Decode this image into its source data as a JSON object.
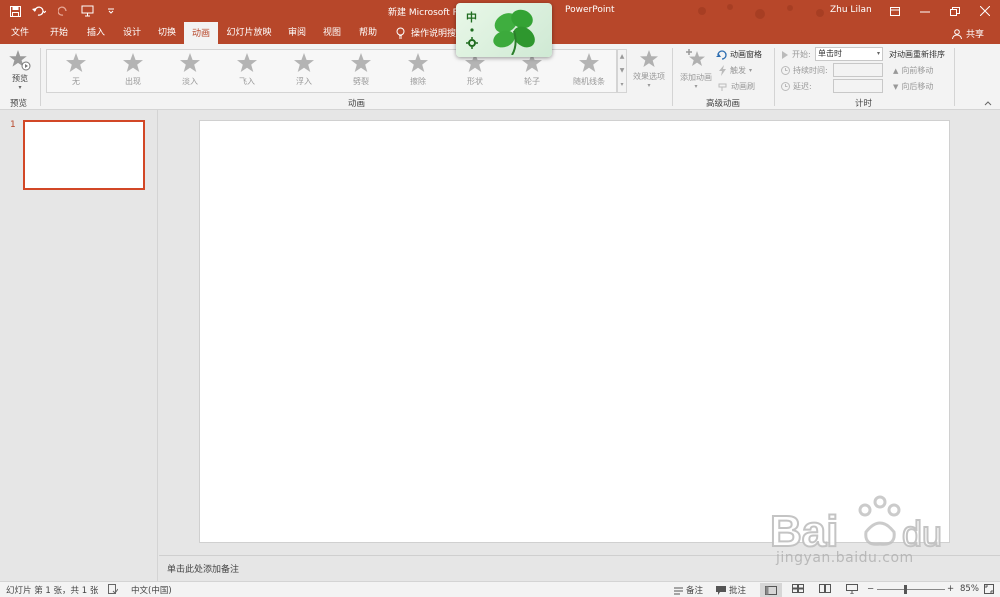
{
  "window": {
    "title": "新建 Microsoft P",
    "app_name": "PowerPoint",
    "user": "Zhu Lilan"
  },
  "tabs": [
    {
      "label": "文件",
      "active": false
    },
    {
      "label": "开始",
      "active": false
    },
    {
      "label": "插入",
      "active": false
    },
    {
      "label": "设计",
      "active": false
    },
    {
      "label": "切换",
      "active": false
    },
    {
      "label": "动画",
      "active": true
    },
    {
      "label": "幻灯片放映",
      "active": false
    },
    {
      "label": "审阅",
      "active": false
    },
    {
      "label": "视图",
      "active": false
    },
    {
      "label": "帮助",
      "active": false
    }
  ],
  "tell_me": "操作说明搜索",
  "share": "共享",
  "ime": {
    "label": "中"
  },
  "ribbon": {
    "preview": {
      "button": "预览",
      "group": "预览"
    },
    "animations": {
      "group": "动画",
      "items": [
        "无",
        "出现",
        "淡入",
        "飞入",
        "浮入",
        "劈裂",
        "擦除",
        "形状",
        "轮子",
        "随机线条"
      ],
      "effect_options": "效果选项"
    },
    "advanced": {
      "group": "高级动画",
      "add_animation": "添加动画",
      "animation_pane": "动画窗格",
      "trigger": "触发",
      "painter": "动画刷"
    },
    "timing": {
      "group": "计时",
      "start_label": "开始:",
      "start_value": "单击时",
      "duration_label": "持续时间:",
      "delay_label": "延迟:",
      "reorder_title": "对动画重新排序",
      "move_earlier": "向前移动",
      "move_later": "向后移动"
    }
  },
  "slides": {
    "thumb_number": "1"
  },
  "notes": {
    "placeholder": "单击此处添加备注"
  },
  "status": {
    "slide_info": "幻灯片 第 1 张，共 1 张",
    "language": "中文(中国)",
    "notes": "备注",
    "comments": "批注",
    "zoom": "85%",
    "zoom_minus": "−",
    "zoom_plus": "+"
  },
  "watermark": {
    "url": "jingyan.baidu.com"
  },
  "colors": {
    "accent": "#b7472a",
    "selection": "#d24726"
  }
}
